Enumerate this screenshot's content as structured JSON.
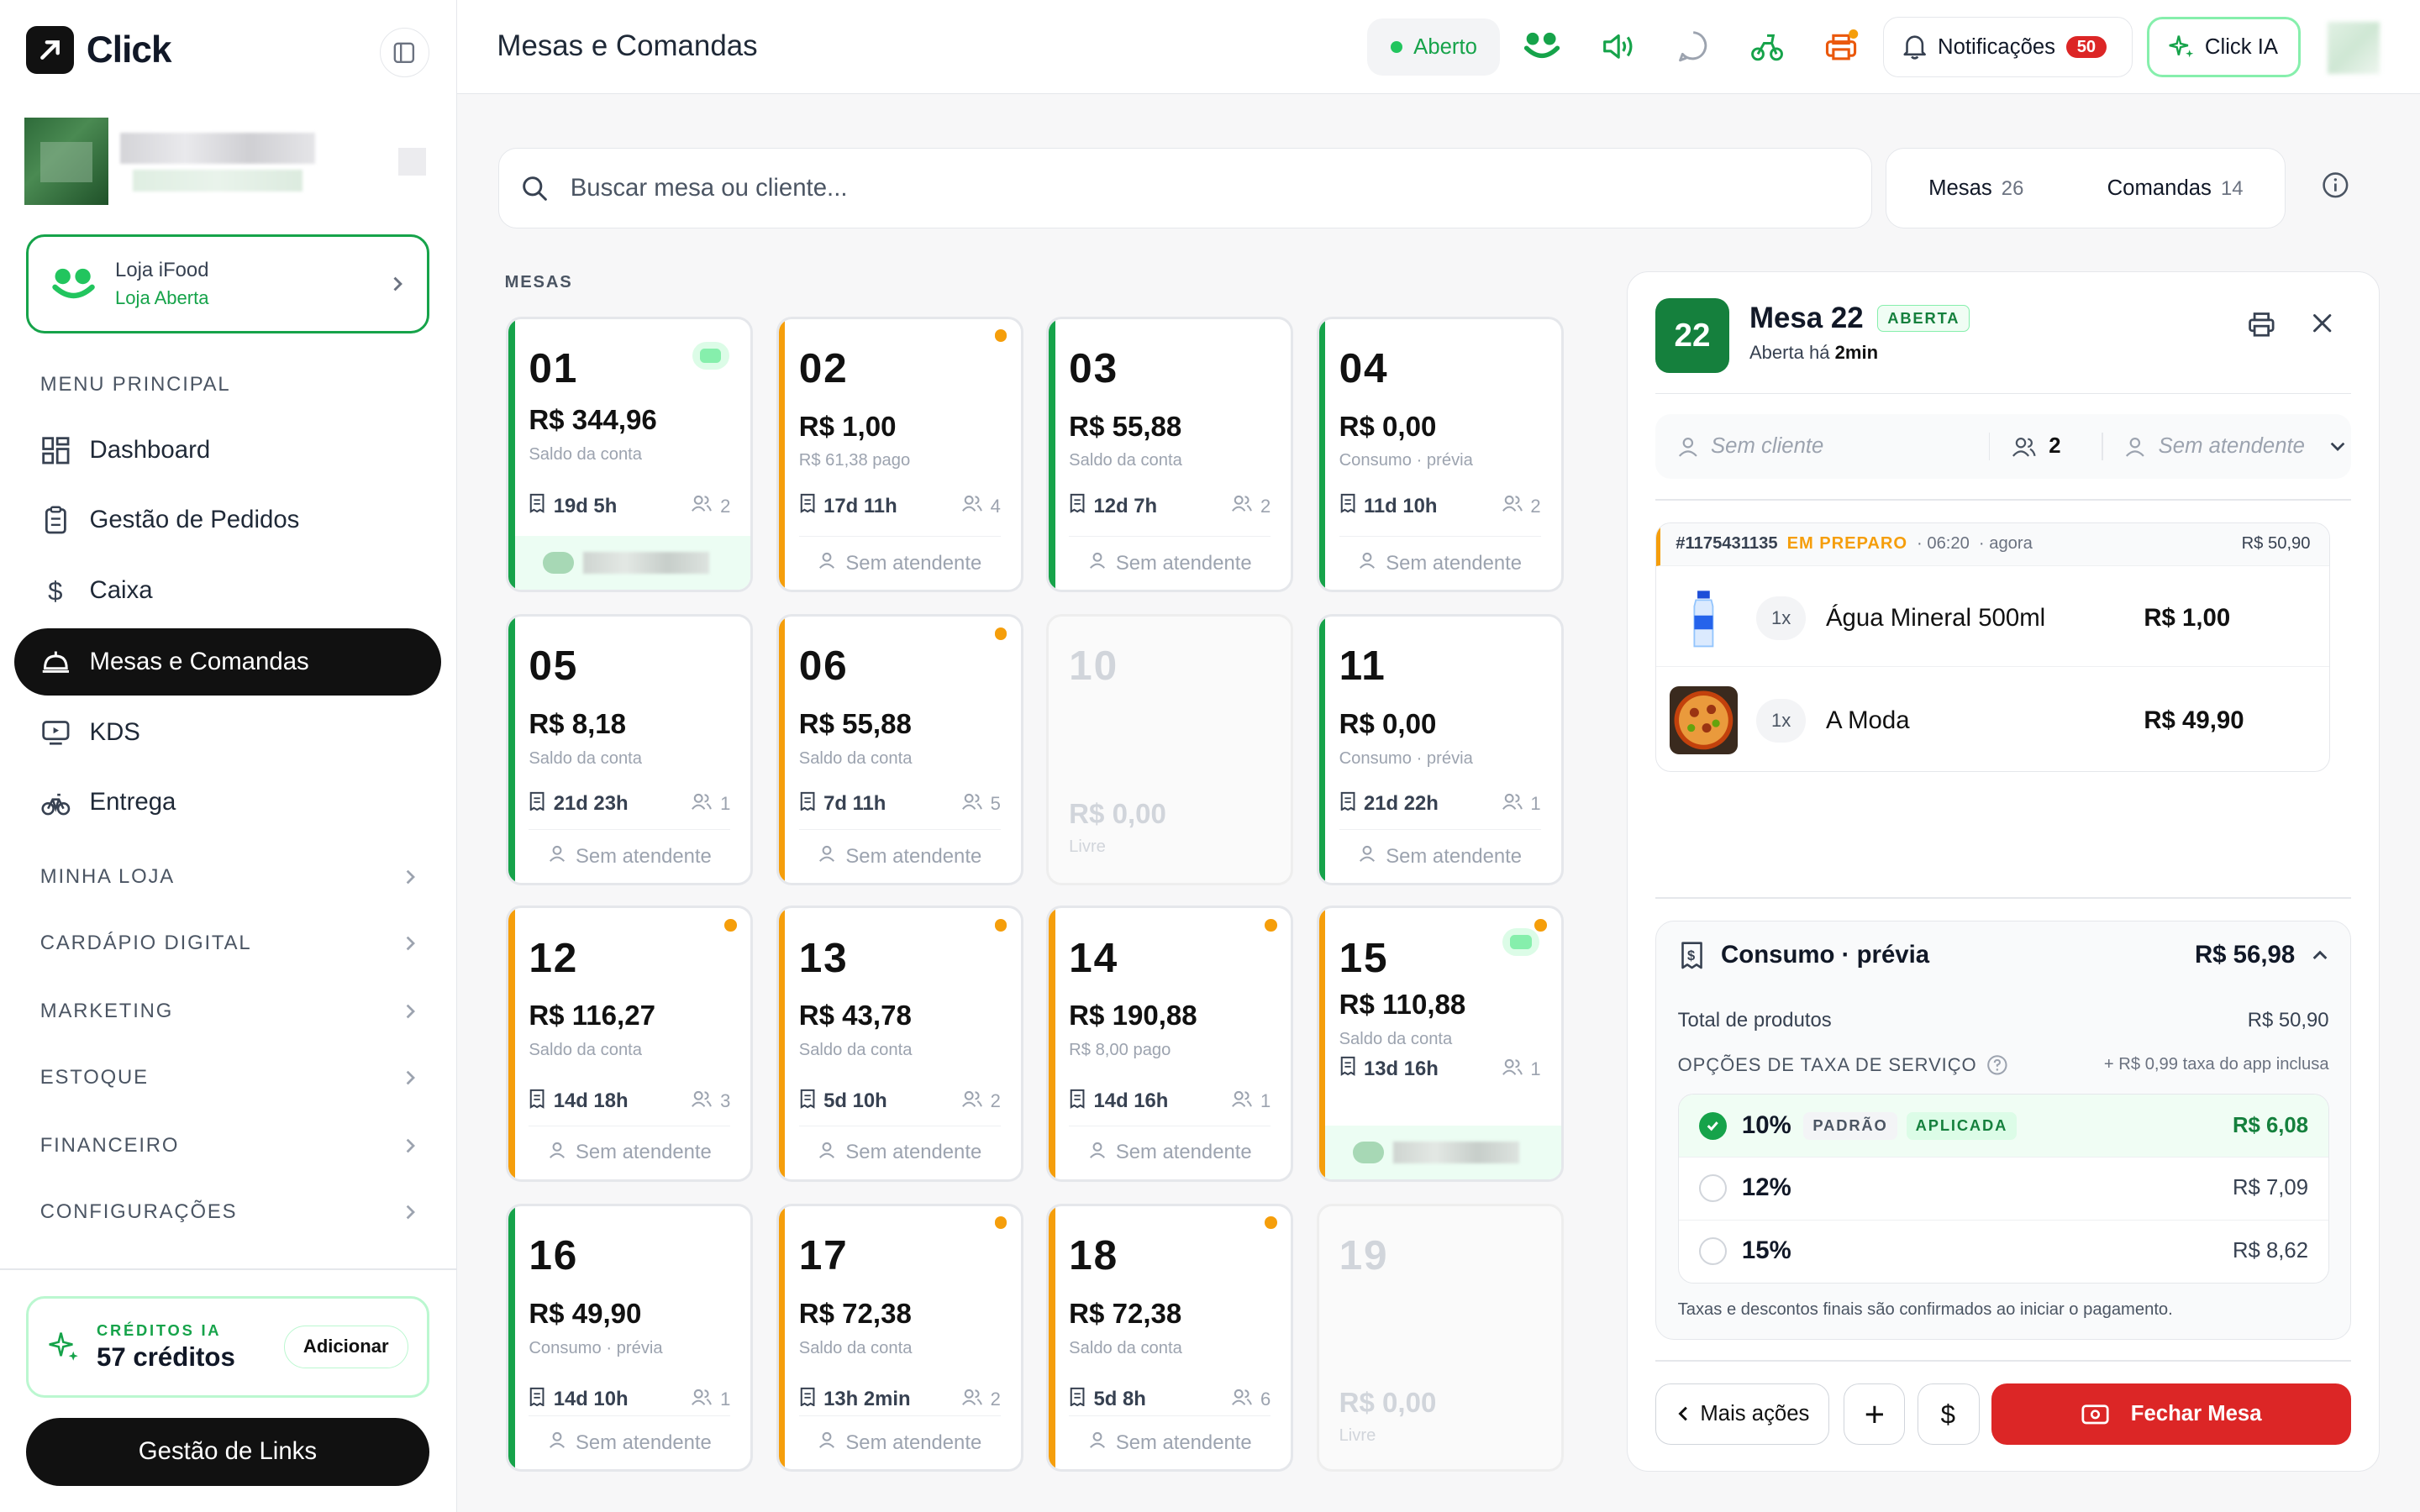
{
  "app": {
    "logo_text": "Click"
  },
  "sidebar": {
    "ifood": {
      "title": "Loja iFood",
      "status": "Loja Aberta"
    },
    "menu_label": "MENU PRINCIPAL",
    "items": [
      {
        "label": "Dashboard",
        "icon": "dashboard-icon",
        "active": false
      },
      {
        "label": "Gestão de Pedidos",
        "icon": "clipboard-icon",
        "active": false
      },
      {
        "label": "Caixa",
        "icon": "dollar-icon",
        "active": false
      },
      {
        "label": "Mesas e Comandas",
        "icon": "table-bell-icon",
        "active": true
      },
      {
        "label": "KDS",
        "icon": "monitor-icon",
        "active": false
      },
      {
        "label": "Entrega",
        "icon": "bike-icon",
        "active": false
      }
    ],
    "groups": [
      "MINHA LOJA",
      "CARDÁPIO DIGITAL",
      "MARKETING",
      "ESTOQUE",
      "FINANCEIRO",
      "CONFIGURAÇÕES"
    ],
    "credits": {
      "label": "CRÉDITOS IA",
      "value": "57 créditos",
      "add_label": "Adicionar"
    },
    "links_button": "Gestão de Links"
  },
  "topbar": {
    "title": "Mesas e Comandas",
    "status": "Aberto",
    "notifications_label": "Notificações",
    "notifications_count": "50",
    "ai_button": "Click IA"
  },
  "search": {
    "placeholder": "Buscar mesa ou cliente..."
  },
  "toggle": {
    "mesas_label": "Mesas",
    "mesas_count": "26",
    "comandas_label": "Comandas",
    "comandas_count": "14"
  },
  "section_label": "MESAS",
  "tables": [
    {
      "num": "01",
      "amount": "R$ 344,96",
      "sub": "Saldo da conta",
      "time": "19d 5h",
      "people": "2",
      "status": "green",
      "attendant": "",
      "ifood": true,
      "dot": false
    },
    {
      "num": "02",
      "amount": "R$ 1,00",
      "sub": "R$ 61,38 pago",
      "time": "17d 11h",
      "people": "4",
      "status": "orange",
      "attendant": "Sem atendente",
      "ifood": false,
      "dot": true
    },
    {
      "num": "03",
      "amount": "R$ 55,88",
      "sub": "Saldo da conta",
      "time": "12d 7h",
      "people": "2",
      "status": "green",
      "attendant": "Sem atendente",
      "ifood": false,
      "dot": false
    },
    {
      "num": "04",
      "amount": "R$ 0,00",
      "sub": "Consumo · prévia",
      "time": "11d 10h",
      "people": "2",
      "status": "green",
      "attendant": "Sem atendente",
      "ifood": false,
      "dot": false
    },
    {
      "num": "05",
      "amount": "R$ 8,18",
      "sub": "Saldo da conta",
      "time": "21d 23h",
      "people": "1",
      "status": "green",
      "attendant": "Sem atendente",
      "ifood": false,
      "dot": false
    },
    {
      "num": "06",
      "amount": "R$ 55,88",
      "sub": "Saldo da conta",
      "time": "7d 11h",
      "people": "5",
      "status": "orange",
      "attendant": "Sem atendente",
      "ifood": false,
      "dot": true
    },
    {
      "num": "10",
      "amount": "R$ 0,00",
      "sub": "Livre",
      "time": "",
      "people": "",
      "status": "empty",
      "attendant": "",
      "ifood": false,
      "dot": false
    },
    {
      "num": "11",
      "amount": "R$ 0,00",
      "sub": "Consumo · prévia",
      "time": "21d 22h",
      "people": "1",
      "status": "green",
      "attendant": "Sem atendente",
      "ifood": false,
      "dot": false
    },
    {
      "num": "12",
      "amount": "R$ 116,27",
      "sub": "Saldo da conta",
      "time": "14d 18h",
      "people": "3",
      "status": "orange",
      "attendant": "Sem atendente",
      "ifood": false,
      "dot": true
    },
    {
      "num": "13",
      "amount": "R$ 43,78",
      "sub": "Saldo da conta",
      "time": "5d 10h",
      "people": "2",
      "status": "orange",
      "attendant": "Sem atendente",
      "ifood": false,
      "dot": true
    },
    {
      "num": "14",
      "amount": "R$ 190,88",
      "sub": "R$ 8,00 pago",
      "time": "14d 16h",
      "people": "1",
      "status": "orange",
      "attendant": "Sem atendente",
      "ifood": false,
      "dot": true
    },
    {
      "num": "15",
      "amount": "R$ 110,88",
      "sub": "Saldo da conta",
      "time": "13d 16h",
      "people": "1",
      "status": "orange",
      "attendant": "",
      "ifood": true,
      "dot": true
    },
    {
      "num": "16",
      "amount": "R$ 49,90",
      "sub": "Consumo · prévia",
      "time": "14d 10h",
      "people": "1",
      "status": "green",
      "attendant": "Sem atendente",
      "ifood": false,
      "dot": false
    },
    {
      "num": "17",
      "amount": "R$ 72,38",
      "sub": "Saldo da conta",
      "time": "13h 2min",
      "people": "2",
      "status": "orange",
      "attendant": "Sem atendente",
      "ifood": false,
      "dot": true
    },
    {
      "num": "18",
      "amount": "R$ 72,38",
      "sub": "Saldo da conta",
      "time": "5d 8h",
      "people": "6",
      "status": "orange",
      "attendant": "Sem atendente",
      "ifood": false,
      "dot": true
    },
    {
      "num": "19",
      "amount": "R$ 0,00",
      "sub": "Livre",
      "time": "",
      "people": "",
      "status": "empty",
      "attendant": "",
      "ifood": false,
      "dot": false
    }
  ],
  "panel": {
    "badge": "22",
    "title": "Mesa 22",
    "tag": "ABERTA",
    "opened_prefix": "Aberta há",
    "opened_value": "2min",
    "client": "Sem cliente",
    "people": "2",
    "attendant": "Sem atendente",
    "order": {
      "id": "#1175431135",
      "status": "EM PREPARO",
      "time": "· 06:20",
      "ago": "· agora",
      "total": "R$ 50,90",
      "items": [
        {
          "qty": "1x",
          "name": "Água Mineral 500ml",
          "price": "R$ 1,00"
        },
        {
          "qty": "1x",
          "name": "A Moda",
          "price": "R$ 49,90"
        }
      ]
    },
    "consumo": {
      "title": "Consumo · prévia",
      "total": "R$ 56,98",
      "products_label": "Total de produtos",
      "products_value": "R$ 50,90",
      "fee_label": "OPÇÕES DE TAXA DE SERVIÇO",
      "fee_note": "+ R$ 0,99 taxa do app inclusa",
      "options": [
        {
          "pct": "10%",
          "value": "R$ 6,08",
          "selected": true,
          "chips": [
            "PADRÃO",
            "APLICADA"
          ]
        },
        {
          "pct": "12%",
          "value": "R$ 7,09",
          "selected": false,
          "chips": []
        },
        {
          "pct": "15%",
          "value": "R$ 8,62",
          "selected": false,
          "chips": []
        }
      ],
      "footnote": "Taxas e descontos finais são confirmados ao iniciar o pagamento."
    },
    "actions": {
      "more": "Mais ações",
      "close": "Fechar Mesa"
    }
  },
  "colors": {
    "green": "#16a34a",
    "orange": "#f59e0b",
    "red": "#dc2626",
    "dark": "#111111"
  }
}
